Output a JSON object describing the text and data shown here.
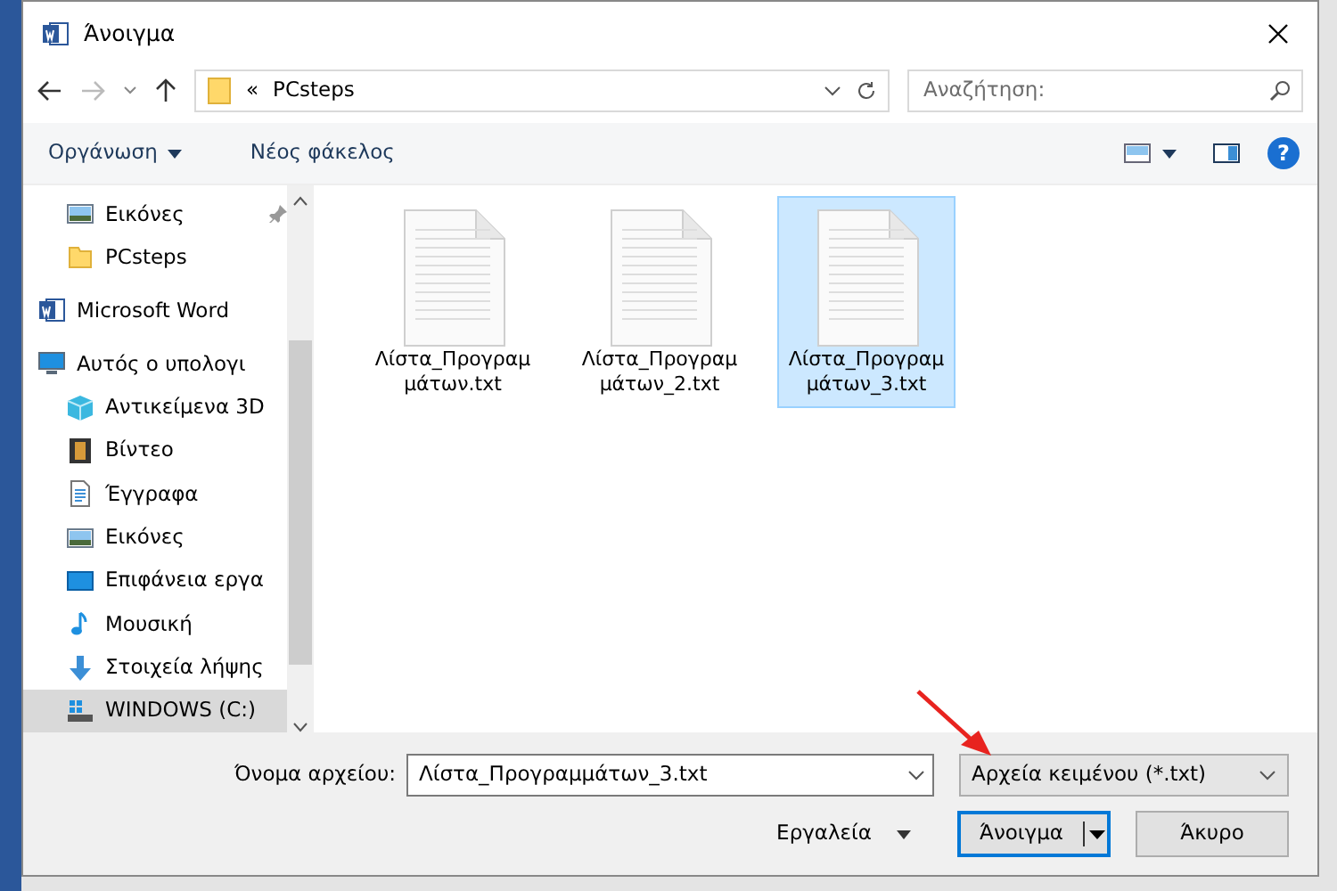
{
  "window": {
    "title": "Άνοιγμα"
  },
  "address_bar": {
    "overflow": "«",
    "path": "PCsteps"
  },
  "search": {
    "placeholder": "Αναζήτηση:"
  },
  "toolbar": {
    "organize": "Οργάνωση",
    "new_folder": "Νέος φάκελος",
    "help": "?"
  },
  "quick_access_items": [
    {
      "label": "Εικόνες",
      "kind": "pictures",
      "pinned": true,
      "selected": false
    },
    {
      "label": "PCsteps",
      "kind": "folder",
      "pinned": false,
      "selected": false
    }
  ],
  "sidebar_items": [
    {
      "label": "Microsoft Word",
      "kind": "word",
      "selected": false
    },
    {
      "label": "Αυτός ο υπολογι",
      "kind": "computer",
      "selected": false,
      "children": [
        {
          "label": "Αντικείμενα 3D",
          "kind": "cube",
          "selected": false
        },
        {
          "label": "Βίντεο",
          "kind": "video",
          "selected": false
        },
        {
          "label": "Έγγραφα",
          "kind": "documents",
          "selected": false
        },
        {
          "label": "Εικόνες",
          "kind": "pictures",
          "selected": false
        },
        {
          "label": "Επιφάνεια εργα",
          "kind": "desktop",
          "selected": false
        },
        {
          "label": "Μουσική",
          "kind": "music",
          "selected": false
        },
        {
          "label": "Στοιχεία λήψης",
          "kind": "downloads",
          "selected": false
        },
        {
          "label": "WINDOWS (C:)",
          "kind": "drive",
          "selected": true
        }
      ]
    }
  ],
  "files": [
    {
      "name": "Λίστα_Προγραμμάτων.txt",
      "selected": false
    },
    {
      "name": "Λίστα_Προγραμμάτων_2.txt",
      "selected": false
    },
    {
      "name": "Λίστα_Προγραμμάτων_3.txt",
      "selected": true
    }
  ],
  "footer": {
    "filename_label": "Όνομα αρχείου:",
    "filename": "Λίστα_Προγραμμάτων_3.txt",
    "filter": "Αρχεία κειμένου (*.txt)",
    "tools": "Εργαλεία",
    "open": "Άνοιγμα",
    "cancel": "Άκυρο"
  }
}
